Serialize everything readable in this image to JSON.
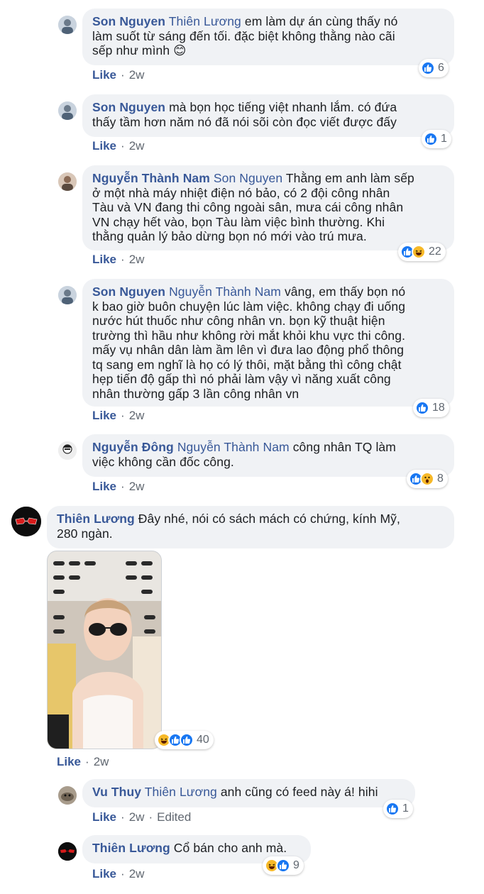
{
  "comments": [
    {
      "name": "Son Nguyen",
      "tag": "Thiên Lương",
      "text_lines": [
        "em làm dự án cùng thấy nó",
        "làm suốt từ sáng đến tối. đặc biệt không thằng nào cãi",
        "sếp như mình 😊"
      ],
      "like": "Like",
      "time": "2w",
      "reaction_count": "6"
    },
    {
      "name": "Son Nguyen",
      "tag": "",
      "text_lines": [
        "mà bọn học tiếng việt nhanh lắm. có đứa",
        "thấy tầm hơn năm nó đã nói sõi còn đọc viết được đấy"
      ],
      "like": "Like",
      "time": "2w",
      "reaction_count": "1"
    },
    {
      "name": "Nguyễn Thành Nam",
      "tag": "Son Nguyen",
      "text_lines": [
        "Thằng em anh làm sếp",
        "ở một nhà máy nhiệt điện nó bảo, có 2 đội công nhân",
        "Tàu và VN đang thi công ngoài sân, mưa cái công nhân",
        "VN chạy hết vào, bọn Tàu làm việc bình thường. Khi",
        "thằng quản lý bảo dừng bọn nó mới vào trú mưa."
      ],
      "like": "Like",
      "time": "2w",
      "reaction_count": "22"
    },
    {
      "name": "Son Nguyen",
      "tag": "Nguyễn Thành Nam",
      "text_lines": [
        "vâng, em thấy bọn nó",
        "k bao giờ buôn chuyện lúc làm việc. không chạy đi uống",
        "nước hút thuốc như công nhân vn. bọn kỹ thuật hiện",
        "trường thì hầu như không rời mắt khỏi khu vực thi công.",
        "mấy vụ nhân dân làm ầm lên vì đưa lao động phổ thông",
        "tq sang em nghĩ là họ có lý thôi, mặt bằng thì công chật",
        "hẹp tiến độ gấp thì nó phải làm vậy vì năng xuất công",
        "nhân thường gấp 3 lần công nhân vn"
      ],
      "like": "Like",
      "time": "2w",
      "reaction_count": "18"
    },
    {
      "name": "Nguyễn Đông",
      "tag": "Nguyễn Thành Nam",
      "text_lines": [
        "công nhân TQ làm",
        "việc không cần đốc công."
      ],
      "like": "Like",
      "time": "2w",
      "reaction_count": "8"
    }
  ],
  "main_comment": {
    "name": "Thiên Lương",
    "text_lines": [
      "Đây nhé, nói có sách mách có chứng, kính Mỹ,",
      "280 ngàn."
    ],
    "reaction_count": "40",
    "like": "Like",
    "time": "2w"
  },
  "replies": [
    {
      "name": "Vu Thuy",
      "tag": "Thiên Lương",
      "text": "anh cũng có feed này á! hihi",
      "like": "Like",
      "time": "2w",
      "edited": "Edited",
      "reaction_count": "1"
    },
    {
      "name": "Thiên Lương",
      "tag": "",
      "text": "Cổ bán cho anh mà.",
      "like": "Like",
      "time": "2w",
      "reaction_count": "9"
    }
  ],
  "colors": {
    "name_link": "#385898",
    "bubble_bg": "#f0f2f5",
    "like_blue": "#1877f2",
    "haha_yellow": "#f7b928"
  }
}
